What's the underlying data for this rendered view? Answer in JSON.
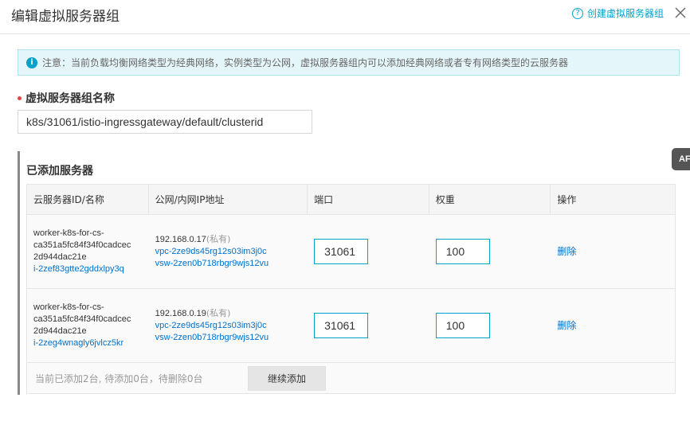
{
  "header": {
    "title": "编辑虚拟服务器组",
    "create_link": "创建虚拟服务器组",
    "help_icon": "?"
  },
  "notice": {
    "icon": "i",
    "text": "注意：当前负载均衡网络类型为经典网络，实例类型为公网，虚拟服务器组内可以添加经典网络或者专有网络类型的云服务器"
  },
  "form": {
    "name_label": "虚拟服务器组名称",
    "name_value": "k8s/31061/istio-ingressgateway/default/clusterid"
  },
  "servers": {
    "title": "已添加服务器",
    "columns": [
      "云服务器ID/名称",
      "公网/内网IP地址",
      "端口",
      "权重",
      "操作"
    ],
    "rows": [
      {
        "name_lines": [
          "worker-k8s-for-cs-",
          "ca351a5fc84f34f0cadcec",
          "2d944dac21e"
        ],
        "instance_id": "i-2zef83gtte2gddxlpy3q",
        "ip": "192.168.0.17",
        "ip_type": "(私有)",
        "vpc": "vpc-2ze9ds45rg12s03im3j0c",
        "vsw": "vsw-2zen0b718rbgr9wjs12vu",
        "port": "31061",
        "weight": "100",
        "action": "删除"
      },
      {
        "name_lines": [
          "worker-k8s-for-cs-",
          "ca351a5fc84f34f0cadcec",
          "2d944dac21e"
        ],
        "instance_id": "i-2zeg4wnagly6jvlcz5kr",
        "ip": "192.168.0.19",
        "ip_type": "(私有)",
        "vpc": "vpc-2ze9ds45rg12s03im3j0c",
        "vsw": "vsw-2zen0b718rbgr9wjs12vu",
        "port": "31061",
        "weight": "100",
        "action": "删除"
      }
    ],
    "summary": "当前已添加2台, 待添加0台，待删除0台",
    "add_button": "继续添加"
  },
  "side_tab": {
    "label": "AF"
  },
  "colors": {
    "accent": "#00a2ca",
    "link": "#0070cc",
    "required": "#e64545"
  },
  "icons": {
    "close": "close-icon",
    "help": "help-circle-icon",
    "info": "info-icon"
  }
}
